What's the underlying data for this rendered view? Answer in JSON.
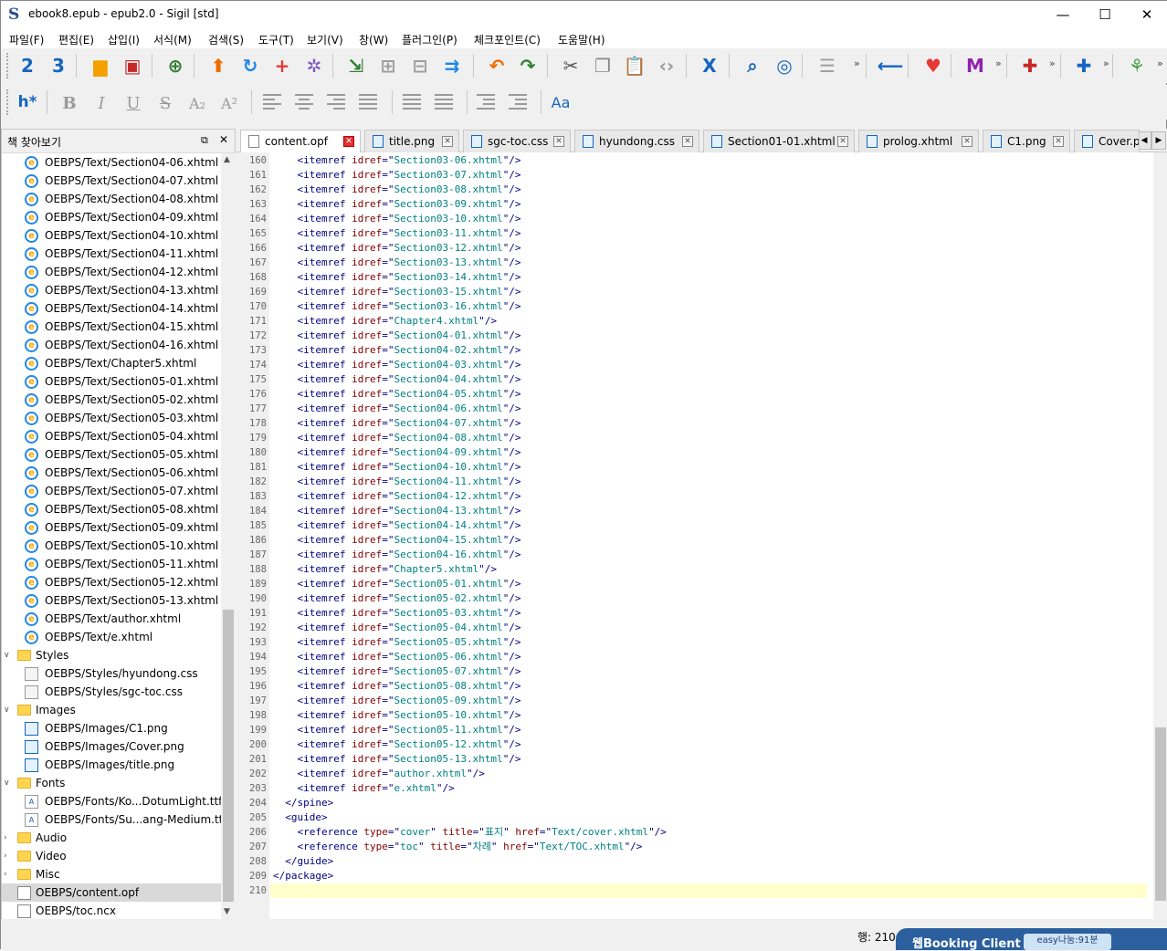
{
  "window": {
    "title": "ebook8.epub - epub2.0 - Sigil [std]",
    "minimize": "—",
    "maximize": "☐",
    "close": "✕"
  },
  "menu": [
    "파일(F)",
    "편집(E)",
    "삽입(I)",
    "서식(M)",
    "검색(S)",
    "도구(T)",
    "보기(V)",
    "창(W)",
    "플러그인(P)",
    "체크포인트(C)",
    "도움말(H)"
  ],
  "toolbar": {
    "icons": [
      "heading-2-icon",
      "heading-3-icon",
      "open-folder-icon",
      "save-icon",
      "add-file-icon",
      "upload-arrow-icon",
      "refresh-icon",
      "add-existing-icon",
      "settings-gear-icon",
      "insert-file-icon",
      "insert-image-icon",
      "insert-special-icon",
      "split-icon",
      "undo-icon",
      "redo-icon",
      "cut-icon",
      "copy-icon",
      "paste-icon",
      "code-view-icon",
      "x-icon",
      "search-icon",
      "search-replace-icon",
      "page-break-icon",
      "back-arrow-icon",
      "heart-icon",
      "m-icon",
      "plugin-1-icon",
      "plugin-6-icon",
      "tree-icon"
    ],
    "heading_button": "h*",
    "font_button": "Aa",
    "more": "»"
  },
  "format": {
    "bold": "B",
    "italic": "I",
    "underline": "U",
    "strike": "S",
    "sub": "A₂",
    "sup": "A²"
  },
  "panel": {
    "title": "책 찾아보기",
    "float": "⧉",
    "close": "✕",
    "items": [
      {
        "label": "OEBPS/Text/Section04-06.xhtml",
        "type": "xhtml"
      },
      {
        "label": "OEBPS/Text/Section04-07.xhtml",
        "type": "xhtml"
      },
      {
        "label": "OEBPS/Text/Section04-08.xhtml",
        "type": "xhtml"
      },
      {
        "label": "OEBPS/Text/Section04-09.xhtml",
        "type": "xhtml"
      },
      {
        "label": "OEBPS/Text/Section04-10.xhtml",
        "type": "xhtml"
      },
      {
        "label": "OEBPS/Text/Section04-11.xhtml",
        "type": "xhtml"
      },
      {
        "label": "OEBPS/Text/Section04-12.xhtml",
        "type": "xhtml"
      },
      {
        "label": "OEBPS/Text/Section04-13.xhtml",
        "type": "xhtml"
      },
      {
        "label": "OEBPS/Text/Section04-14.xhtml",
        "type": "xhtml"
      },
      {
        "label": "OEBPS/Text/Section04-15.xhtml",
        "type": "xhtml"
      },
      {
        "label": "OEBPS/Text/Section04-16.xhtml",
        "type": "xhtml"
      },
      {
        "label": "OEBPS/Text/Chapter5.xhtml",
        "type": "xhtml"
      },
      {
        "label": "OEBPS/Text/Section05-01.xhtml",
        "type": "xhtml"
      },
      {
        "label": "OEBPS/Text/Section05-02.xhtml",
        "type": "xhtml"
      },
      {
        "label": "OEBPS/Text/Section05-03.xhtml",
        "type": "xhtml"
      },
      {
        "label": "OEBPS/Text/Section05-04.xhtml",
        "type": "xhtml"
      },
      {
        "label": "OEBPS/Text/Section05-05.xhtml",
        "type": "xhtml"
      },
      {
        "label": "OEBPS/Text/Section05-06.xhtml",
        "type": "xhtml"
      },
      {
        "label": "OEBPS/Text/Section05-07.xhtml",
        "type": "xhtml"
      },
      {
        "label": "OEBPS/Text/Section05-08.xhtml",
        "type": "xhtml"
      },
      {
        "label": "OEBPS/Text/Section05-09.xhtml",
        "type": "xhtml"
      },
      {
        "label": "OEBPS/Text/Section05-10.xhtml",
        "type": "xhtml"
      },
      {
        "label": "OEBPS/Text/Section05-11.xhtml",
        "type": "xhtml"
      },
      {
        "label": "OEBPS/Text/Section05-12.xhtml",
        "type": "xhtml"
      },
      {
        "label": "OEBPS/Text/Section05-13.xhtml",
        "type": "xhtml"
      },
      {
        "label": "OEBPS/Text/author.xhtml",
        "type": "xhtml"
      },
      {
        "label": "OEBPS/Text/e.xhtml",
        "type": "xhtml"
      },
      {
        "label": "Styles",
        "type": "folder"
      },
      {
        "label": "OEBPS/Styles/hyundong.css",
        "type": "css"
      },
      {
        "label": "OEBPS/Styles/sgc-toc.css",
        "type": "css"
      },
      {
        "label": "Images",
        "type": "folder"
      },
      {
        "label": "OEBPS/Images/C1.png",
        "type": "img"
      },
      {
        "label": "OEBPS/Images/Cover.png",
        "type": "img"
      },
      {
        "label": "OEBPS/Images/title.png",
        "type": "img"
      },
      {
        "label": "Fonts",
        "type": "folder"
      },
      {
        "label": "OEBPS/Fonts/Ko...DotumLight.ttf",
        "type": "ttf"
      },
      {
        "label": "OEBPS/Fonts/Su...ang-Medium.ttf",
        "type": "ttf"
      },
      {
        "label": "Audio",
        "type": "folder-closed"
      },
      {
        "label": "Video",
        "type": "folder-closed"
      },
      {
        "label": "Misc",
        "type": "folder-closed"
      },
      {
        "label": "OEBPS/content.opf",
        "type": "doc",
        "selected": true
      },
      {
        "label": "OEBPS/toc.ncx",
        "type": "doc"
      }
    ]
  },
  "tabs": [
    {
      "label": "content.opf",
      "active": true
    },
    {
      "label": "title.png"
    },
    {
      "label": "sgc-toc.css"
    },
    {
      "label": "hyundong.css"
    },
    {
      "label": "Section01-01.xhtml"
    },
    {
      "label": "prolog.xhtml"
    },
    {
      "label": "C1.png"
    },
    {
      "label": "Cover.pr"
    }
  ],
  "code": [
    {
      "n": "160",
      "t": "itemref",
      "id": "Section03-06.xhtml"
    },
    {
      "n": "161",
      "t": "itemref",
      "id": "Section03-07.xhtml"
    },
    {
      "n": "162",
      "t": "itemref",
      "id": "Section03-08.xhtml"
    },
    {
      "n": "163",
      "t": "itemref",
      "id": "Section03-09.xhtml"
    },
    {
      "n": "164",
      "t": "itemref",
      "id": "Section03-10.xhtml"
    },
    {
      "n": "165",
      "t": "itemref",
      "id": "Section03-11.xhtml"
    },
    {
      "n": "166",
      "t": "itemref",
      "id": "Section03-12.xhtml"
    },
    {
      "n": "167",
      "t": "itemref",
      "id": "Section03-13.xhtml"
    },
    {
      "n": "168",
      "t": "itemref",
      "id": "Section03-14.xhtml"
    },
    {
      "n": "169",
      "t": "itemref",
      "id": "Section03-15.xhtml"
    },
    {
      "n": "170",
      "t": "itemref",
      "id": "Section03-16.xhtml"
    },
    {
      "n": "171",
      "t": "itemref",
      "id": "Chapter4.xhtml"
    },
    {
      "n": "172",
      "t": "itemref",
      "id": "Section04-01.xhtml"
    },
    {
      "n": "173",
      "t": "itemref",
      "id": "Section04-02.xhtml"
    },
    {
      "n": "174",
      "t": "itemref",
      "id": "Section04-03.xhtml"
    },
    {
      "n": "175",
      "t": "itemref",
      "id": "Section04-04.xhtml"
    },
    {
      "n": "176",
      "t": "itemref",
      "id": "Section04-05.xhtml"
    },
    {
      "n": "177",
      "t": "itemref",
      "id": "Section04-06.xhtml"
    },
    {
      "n": "178",
      "t": "itemref",
      "id": "Section04-07.xhtml"
    },
    {
      "n": "179",
      "t": "itemref",
      "id": "Section04-08.xhtml"
    },
    {
      "n": "180",
      "t": "itemref",
      "id": "Section04-09.xhtml"
    },
    {
      "n": "181",
      "t": "itemref",
      "id": "Section04-10.xhtml"
    },
    {
      "n": "182",
      "t": "itemref",
      "id": "Section04-11.xhtml"
    },
    {
      "n": "183",
      "t": "itemref",
      "id": "Section04-12.xhtml"
    },
    {
      "n": "184",
      "t": "itemref",
      "id": "Section04-13.xhtml"
    },
    {
      "n": "185",
      "t": "itemref",
      "id": "Section04-14.xhtml"
    },
    {
      "n": "186",
      "t": "itemref",
      "id": "Section04-15.xhtml"
    },
    {
      "n": "187",
      "t": "itemref",
      "id": "Section04-16.xhtml"
    },
    {
      "n": "188",
      "t": "itemref",
      "id": "Chapter5.xhtml"
    },
    {
      "n": "189",
      "t": "itemref",
      "id": "Section05-01.xhtml"
    },
    {
      "n": "190",
      "t": "itemref",
      "id": "Section05-02.xhtml"
    },
    {
      "n": "191",
      "t": "itemref",
      "id": "Section05-03.xhtml"
    },
    {
      "n": "192",
      "t": "itemref",
      "id": "Section05-04.xhtml"
    },
    {
      "n": "193",
      "t": "itemref",
      "id": "Section05-05.xhtml"
    },
    {
      "n": "194",
      "t": "itemref",
      "id": "Section05-06.xhtml"
    },
    {
      "n": "195",
      "t": "itemref",
      "id": "Section05-07.xhtml"
    },
    {
      "n": "196",
      "t": "itemref",
      "id": "Section05-08.xhtml"
    },
    {
      "n": "197",
      "t": "itemref",
      "id": "Section05-09.xhtml"
    },
    {
      "n": "198",
      "t": "itemref",
      "id": "Section05-10.xhtml"
    },
    {
      "n": "199",
      "t": "itemref",
      "id": "Section05-11.xhtml"
    },
    {
      "n": "200",
      "t": "itemref",
      "id": "Section05-12.xhtml"
    },
    {
      "n": "201",
      "t": "itemref",
      "id": "Section05-13.xhtml"
    },
    {
      "n": "202",
      "t": "itemref",
      "id": "author.xhtml"
    },
    {
      "n": "203",
      "t": "itemref",
      "id": "e.xhtml"
    },
    {
      "n": "204",
      "t": "raw",
      "raw": "  </spine>"
    },
    {
      "n": "205",
      "t": "raw",
      "raw": "  <guide>"
    },
    {
      "n": "206",
      "t": "ref",
      "type": "cover",
      "title": "표지",
      "href": "Text/cover.xhtml"
    },
    {
      "n": "207",
      "t": "ref",
      "type": "toc",
      "title": "차례",
      "href": "Text/TOC.xhtml"
    },
    {
      "n": "208",
      "t": "raw",
      "raw": "  </guide>"
    },
    {
      "n": "209",
      "t": "raw",
      "raw": "</package>"
    },
    {
      "n": "210",
      "t": "raw",
      "raw": "",
      "current": true
    }
  ],
  "status": {
    "line": "행: 210"
  },
  "taskbar": {
    "label": "웹Booking Client",
    "user": "easy나눔:91분"
  },
  "colors": {
    "tag": "#000080",
    "attr": "#800000",
    "value": "#008080",
    "current_line": "#ffffcc"
  }
}
